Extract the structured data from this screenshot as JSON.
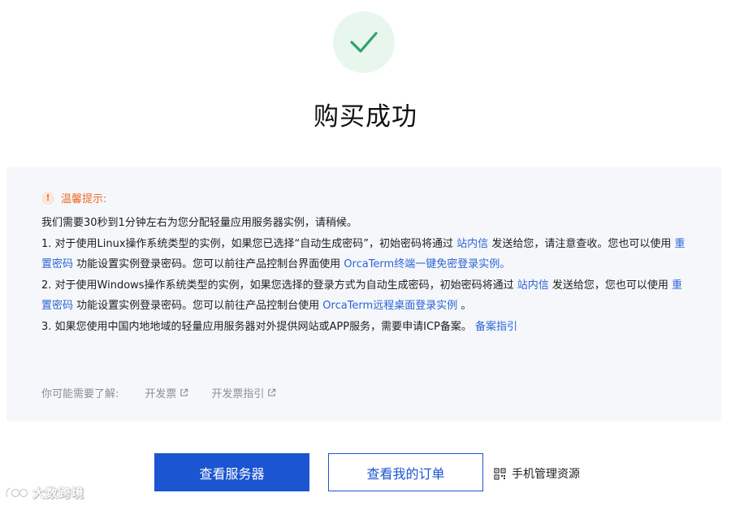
{
  "header": {
    "title": "购买成功"
  },
  "notice": {
    "tip_title": "温馨提示:",
    "intro": "我们需要30秒到1分钟左右为您分配轻量应用服务器实例，请稍候。",
    "item1": {
      "part1": "1. 对于使用Linux操作系统类型的实例，如果您已选择“自动生成密码”，初始密码将通过 ",
      "link1": "站内信",
      "part2": " 发送给您，请注意查收。您也可以使用 ",
      "link2": "重置密码",
      "part3": " 功能设置实例登录密码。您可以前往产品控制台界面使用 ",
      "link3": "OrcaTerm终端一键免密登录实例。"
    },
    "item2": {
      "part1": "2. 对于使用Windows操作系统类型的实例，如果您选择的登录方式为自动生成密码，初始密码将通过 ",
      "link1": "站内信",
      "part2": " 发送给您，您也可以使用 ",
      "link2": "重置密码",
      "part3": " 功能设置实例登录密码。您可以前往产品控制台使用 ",
      "link3": "OrcaTerm远程桌面登录实例",
      "part4": " 。"
    },
    "item3": {
      "part1": "3. 如果您使用中国内地地域的轻量应用服务器对外提供网站或APP服务，需要申请ICP备案。 ",
      "link1": "备案指引"
    }
  },
  "extras": {
    "label": "你可能需要了解:",
    "links": [
      "开发票",
      "开发票指引"
    ]
  },
  "actions": {
    "view_servers": "查看服务器",
    "view_orders": "查看我的订单",
    "mobile_manage": "手机管理资源"
  },
  "watermark": {
    "text": "大数跨境"
  },
  "colors": {
    "primary": "#1c55d1",
    "link": "#2c64d6",
    "success": "#2ba46b",
    "warning": "#f06a2a"
  }
}
